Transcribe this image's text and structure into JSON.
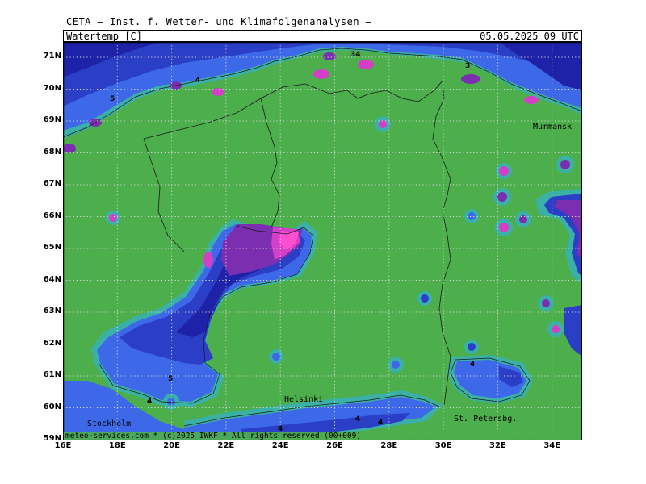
{
  "header": {
    "source": "CETA — Inst. f. Wetter- und Klimafolgenanalysen —",
    "parameter": "Watertemp_[C]",
    "datetime": "05.05.2025 09 UTC"
  },
  "map": {
    "copyright": "meteo-services.com * (c)2025 IWKF * All rights reserved (00+009)",
    "colors": {
      "land": "#4caf4c",
      "coast": "#3bb0a6",
      "cold1": "#3d68e8",
      "cold2": "#2a3ec6",
      "cold3": "#1e22a8",
      "violet": "#7b2fb0",
      "magenta": "#d43fc8",
      "pink": "#ff4fd0",
      "grid": "#c8c8c8",
      "border": "#1a1a1a"
    },
    "lat_labels": [
      "71N",
      "70N",
      "69N",
      "68N",
      "67N",
      "66N",
      "65N",
      "64N",
      "63N",
      "62N",
      "61N",
      "60N",
      "59N"
    ],
    "lon_labels": [
      "16E",
      "18E",
      "20E",
      "22E",
      "24E",
      "26E",
      "28E",
      "30E",
      "32E",
      "34E"
    ],
    "places": {
      "murmansk": "Murmansk",
      "helsinki": "Helsinki",
      "stockholm": "Stockholm",
      "stpetersburg": "St. Petersbg."
    },
    "contour_labels": [
      "5",
      "4",
      "34",
      "3",
      "5",
      "4",
      "4",
      "4",
      "4",
      "4"
    ]
  }
}
